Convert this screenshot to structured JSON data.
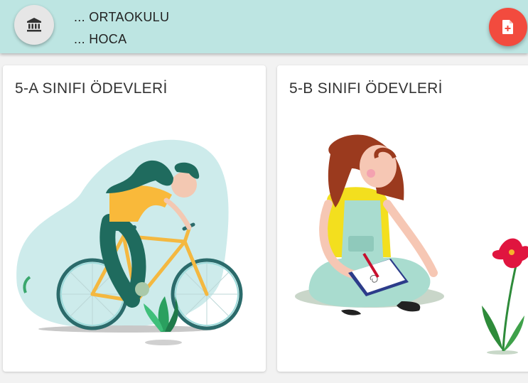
{
  "appbar": {
    "school_name": "... ORTAOKULU",
    "teacher_name": "... HOCA",
    "school_icon": "bank-icon",
    "add_icon": "file-plus-icon"
  },
  "colors": {
    "appbar": "#bde5e2",
    "fab": "#f24b3e"
  },
  "classes": [
    {
      "title": "5-A SINIFI ÖDEVLERİ",
      "illustration": "woman-riding-bicycle"
    },
    {
      "title": "5-B SINIFI ÖDEVLERİ",
      "illustration": "woman-writing-notebook"
    }
  ]
}
